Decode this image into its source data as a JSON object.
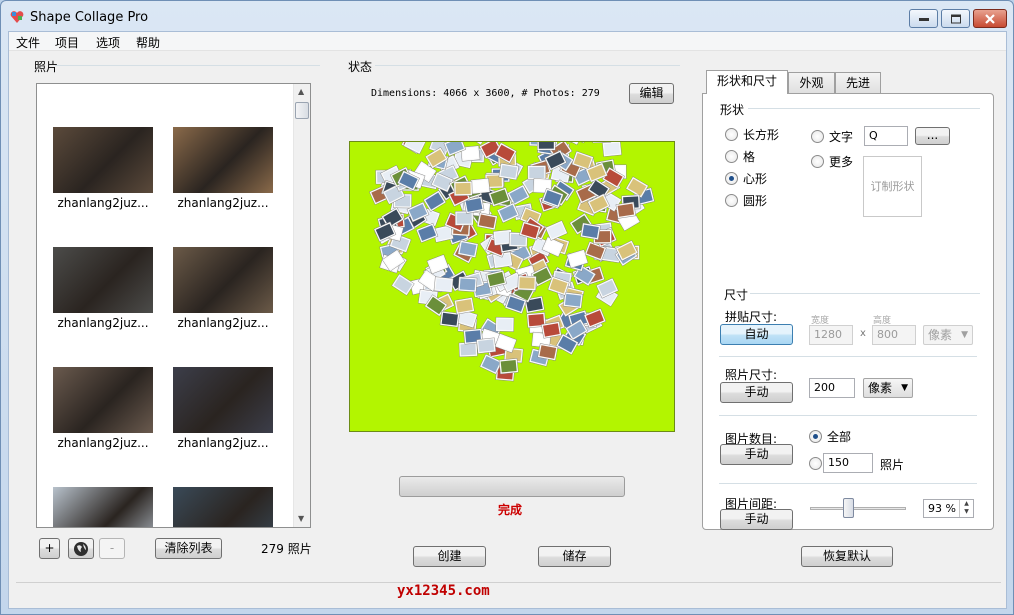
{
  "window": {
    "title": "Shape Collage Pro"
  },
  "menu": [
    "文件",
    "项目",
    "选项",
    "帮助"
  ],
  "photos": {
    "title": "照片",
    "items": [
      {
        "label": "zhanlang2juz...",
        "color": "#5b4a3b"
      },
      {
        "label": "zhanlang2juz...",
        "color": "#8a6a4a"
      },
      {
        "label": "zhanlang2juz...",
        "color": "#4c4c4a"
      },
      {
        "label": "zhanlang2juz...",
        "color": "#6b5a48"
      },
      {
        "label": "zhanlang2juz...",
        "color": "#6a5a4e"
      },
      {
        "label": "zhanlang2juz...",
        "color": "#3c3e4a"
      },
      {
        "label": "",
        "color": "#b8c2cc"
      },
      {
        "label": "",
        "color": "#3a4a58"
      }
    ],
    "add_button": "+",
    "remove_button": "-",
    "clear_button": "清除列表",
    "count": "279 照片"
  },
  "status": {
    "title": "状态",
    "info": "Dimensions: 4066 x 3600, # Photos: 279",
    "edit_button": "编辑",
    "done": "完成",
    "progress": 0,
    "canvas_color": "#b3f500"
  },
  "actions": {
    "create": "创建",
    "save": "储存",
    "restore": "恢复默认"
  },
  "tabs": [
    "形状和尺寸",
    "外观",
    "先进"
  ],
  "shape": {
    "group": "形状",
    "options": [
      {
        "label": "长方形",
        "checked": false
      },
      {
        "label": "格",
        "checked": false
      },
      {
        "label": "心形",
        "checked": true
      },
      {
        "label": "圆形",
        "checked": false
      }
    ],
    "text_option": "文字",
    "text_value": "Q",
    "more_option": "更多",
    "ellipsis": "...",
    "custom_shape": "订制形状"
  },
  "size": {
    "group": "尺寸",
    "collage_size_label": "拼贴尺寸:",
    "collage_mode": "自动",
    "width_label": "宽度",
    "height_label": "高度",
    "width": "1280",
    "x": "x",
    "height": "800",
    "unit": "像素",
    "photo_size_label": "照片尺寸:",
    "photo_mode": "手动",
    "photo_size": "200",
    "photo_unit": "像素",
    "count_label": "图片数目:",
    "count_mode": "手动",
    "all_option": "全部",
    "count_value": "150",
    "count_unit": "照片",
    "spacing_label": "图片间距:",
    "spacing_mode": "手动",
    "spacing_value": "93 %",
    "spacing_level": 0.4
  },
  "footer": {
    "watermark": "yx12345.com"
  }
}
